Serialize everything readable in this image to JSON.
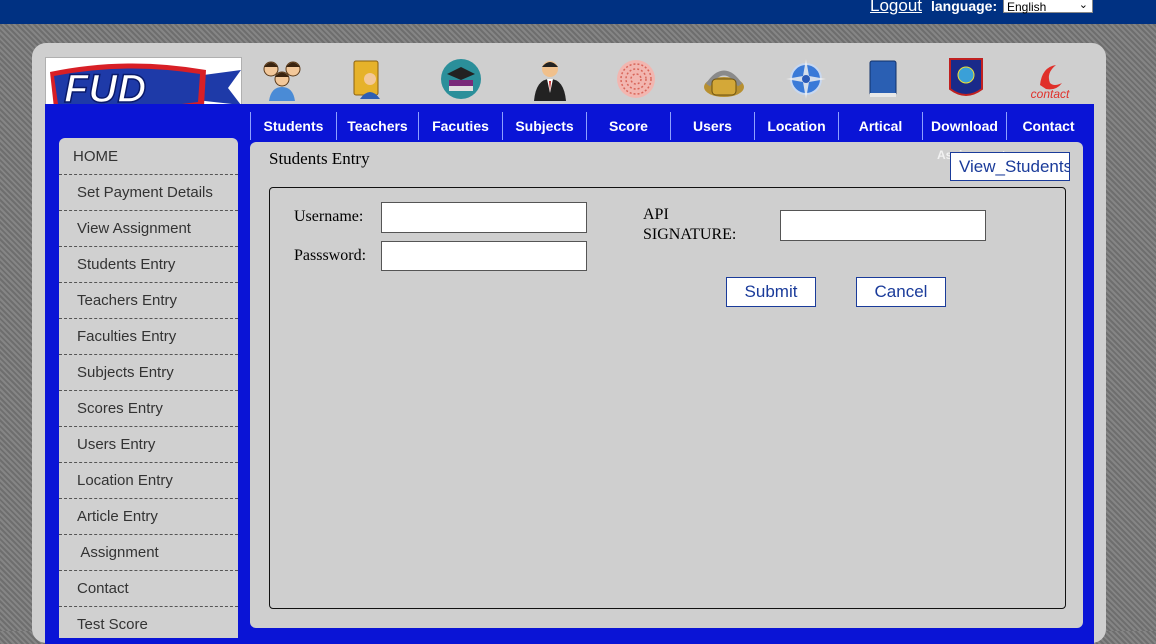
{
  "topbar": {
    "logout_label": "Logout",
    "language_label": "language:",
    "language_value": "English"
  },
  "logo": {
    "text": "FUD"
  },
  "icons": [
    "students-icon",
    "teachers-icon",
    "faculties-icon",
    "subjects-icon",
    "score-icon",
    "users-icon",
    "location-icon",
    "article-icon",
    "download-icon",
    "contact-icon"
  ],
  "contact_icon_text": "contact",
  "nav": [
    "Students",
    "Teachers",
    "Facuties",
    "Subjects",
    "Score",
    "Users",
    "Location",
    "Artical",
    "Download",
    "Contact"
  ],
  "sidebar": [
    "HOME",
    "Set Payment Details",
    "View Assignment",
    "Students Entry",
    "Teachers Entry",
    "Faculties Entry",
    "Subjects Entry",
    "Scores Entry",
    "Users Entry",
    "Location Entry",
    "Article Entry",
    " Assignment",
    "Contact",
    "Test Score"
  ],
  "main": {
    "title": "Students Entry",
    "assignment_ghost": "Assignment",
    "view_button": "View_Students"
  },
  "form": {
    "username_label": "Username:",
    "password_label": "Passsword:",
    "api_label_1": "API",
    "api_label_2": "SIGNATURE:",
    "submit_label": "Submit",
    "cancel_label": "Cancel"
  },
  "colors": {
    "topbar": "#003182",
    "frame": "#0a14d6",
    "panel": "#cfcfcf",
    "button_text": "#1a3b9a"
  }
}
